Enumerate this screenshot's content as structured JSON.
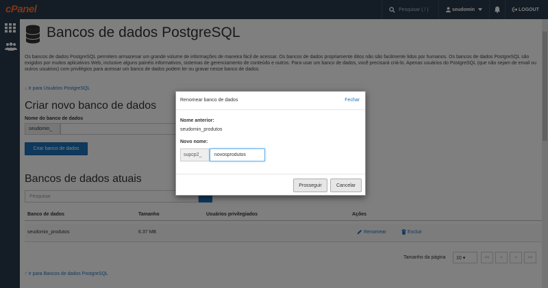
{
  "topbar": {
    "logo": "cPanel",
    "search_placeholder": "Pesquisar ( / )",
    "username": "seudomin",
    "logout_label": "LOGOUT"
  },
  "page": {
    "title": "Bancos de dados PostgreSQL",
    "intro": "Os bancos de dados PostgreSQL permitem armazenar um grande volume de informações de maneira fácil de acessar. Os bancos de dados propriamente ditos não são facilmente lidos por humanos. Os bancos de dados PostgreSQL são exigidos por muitos aplicativos Web, inclusive alguns painéis informativos, sistemas de gerenciamento de conteúdo e outros. Para usar um banco de dados, você precisará criá-lo. Apenas usuários do PostgreSQL (que não sejam de email ou outros usuários) com privilégios para acessar um banco de dados podem ler ou gravar nesse banco de dados.",
    "link_users": "Ir para Usuários PostgreSQL",
    "link_databases": "Ir para Bancos de dados PostgreSQL"
  },
  "create": {
    "heading": "Criar novo banco de dados",
    "field_label": "Nome do banco de dados",
    "prefix": "seudomin_",
    "button": "Criar banco de dados"
  },
  "current": {
    "heading": "Bancos de dados atuais",
    "search_placeholder": "Pesquisar",
    "columns": [
      "Banco de dados",
      "Tamanho",
      "Usuários privilegiados",
      "Ações"
    ],
    "rows": [
      {
        "name": "seudomin_produtos",
        "size": "6.37 MB",
        "users": "",
        "rename": "Renomear",
        "delete": "Excluir"
      }
    ],
    "page_size_label": "Tamanho da página",
    "page_size": "10",
    "pager": [
      "<<",
      "<",
      ">",
      ">>"
    ]
  },
  "modal": {
    "title": "Renomear banco de dados",
    "close": "Fechar",
    "old_label": "Nome anterior:",
    "old_value": "seudomin_produtos",
    "new_label": "Novo nome:",
    "new_prefix": "supcp2_",
    "new_value": "novosprodutos",
    "proceed": "Prosseguir",
    "cancel": "Cancelar"
  },
  "colors": {
    "topbar": "#293a4a",
    "accent": "#1f72b8",
    "logo_accent": "#ff6c2c"
  }
}
